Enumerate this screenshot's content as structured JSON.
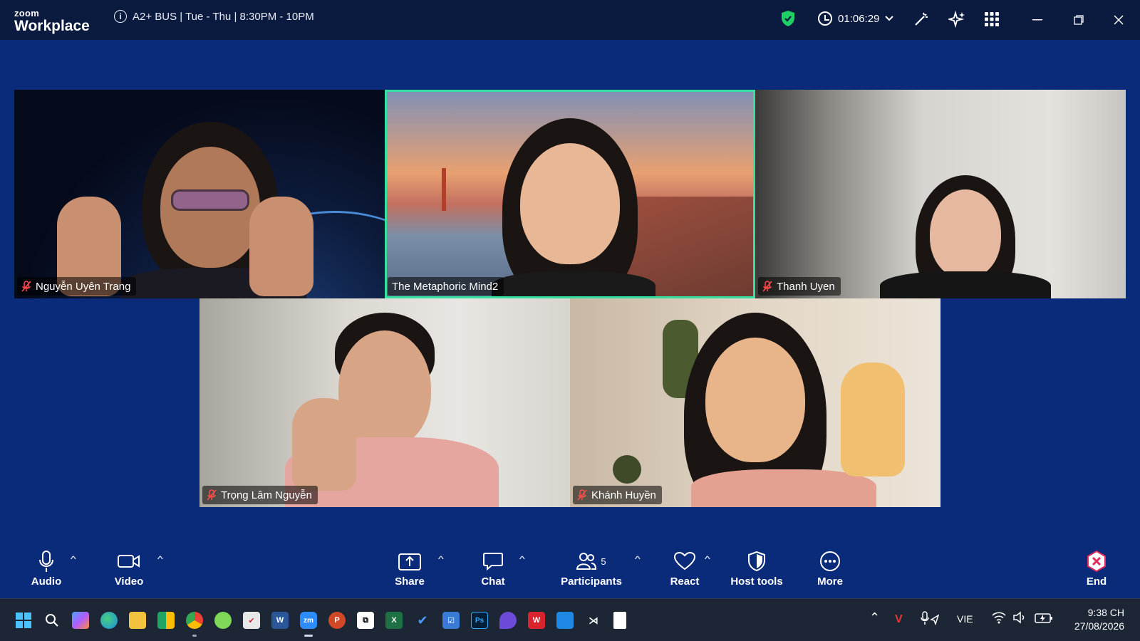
{
  "app": {
    "logo_top": "zoom",
    "logo_bottom": "Workplace"
  },
  "meeting": {
    "topic": "A2+ BUS | Tue - Thu | 8:30PM - 10PM",
    "elapsed": "01:06:29"
  },
  "tiles": [
    {
      "name": "Nguyễn Uyên Trang",
      "muted": true,
      "active": false
    },
    {
      "name": "The Metaphoric Mind2",
      "muted": false,
      "active": true
    },
    {
      "name": "Thanh Uyen",
      "muted": true,
      "active": false
    },
    {
      "name": "Trọng Lâm Nguyễn",
      "muted": true,
      "active": false
    },
    {
      "name": "Khánh Huyền",
      "muted": true,
      "active": false
    }
  ],
  "controls": {
    "audio": "Audio",
    "video": "Video",
    "share": "Share",
    "chat": "Chat",
    "participants": "Participants",
    "participant_count": "5",
    "react": "React",
    "host_tools": "Host tools",
    "more": "More",
    "end": "End"
  },
  "taskbar": {
    "apps": [
      "start-icon",
      "search-icon",
      "copilot-icon",
      "edge-icon",
      "file-explorer-icon",
      "meet-icon",
      "chrome-icon",
      "app-icon",
      "todo-icon",
      "word-icon",
      "zoom-icon",
      "powerpoint-icon",
      "capcut-icon",
      "excel-icon",
      "tasks-icon",
      "planner-icon",
      "photoshop-icon",
      "app-icon",
      "wps-icon",
      "app-icon",
      "capcut-icon",
      "notepad-icon"
    ],
    "zoom_label": "zm",
    "word_label": "W",
    "excel_label": "X",
    "powerpoint_label": "P",
    "photoshop_label": "Ps",
    "language": "VIE",
    "time": "9:38 CH",
    "date": "27/08/2026"
  },
  "colors": {
    "stage_bg": "#0a2a7a",
    "titlebar_bg": "#0b1b3f",
    "active_speaker": "#35e0a0",
    "end_red": "#e02d5a",
    "shield_green": "#1fce64"
  }
}
